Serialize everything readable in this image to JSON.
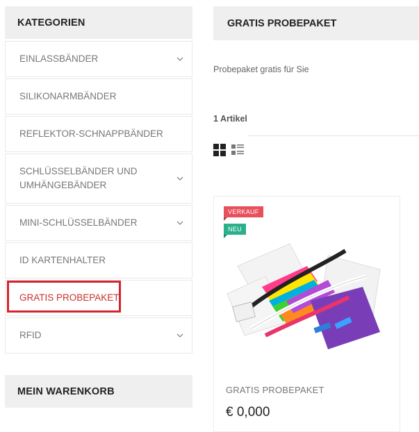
{
  "sidebar": {
    "title": "KATEGORIEN",
    "items": [
      {
        "label": "EINLASSBÄNDER",
        "has_children": true
      },
      {
        "label": "SILIKONARMBÄNDER",
        "has_children": false
      },
      {
        "label": "REFLEKTOR-SCHNAPPBÄNDER",
        "has_children": false
      },
      {
        "label": "SCHLÜSSELBÄNDER UND UMHÄNGEBÄNDER",
        "has_children": true
      },
      {
        "label": "MINI-SCHLÜSSELBÄNDER",
        "has_children": true
      },
      {
        "label": "ID KARTENHALTER",
        "has_children": false
      },
      {
        "label": "GRATIS PROBEPAKET",
        "has_children": false,
        "active": true
      },
      {
        "label": "RFID",
        "has_children": true
      }
    ],
    "cart_title": "MEIN WARENKORB"
  },
  "main": {
    "title": "GRATIS PROBEPAKET",
    "description": "Probepaket gratis für Sie",
    "count": "1 Artikel",
    "product": {
      "badge_sale": "VERKAUF",
      "badge_new": "NEU",
      "name": "GRATIS PROBEPAKET",
      "price": "€ 0,000"
    }
  },
  "colors": {
    "active": "#c9302c",
    "highlight": "#d3232c",
    "sale": "#e8505b",
    "new": "#2bb08b"
  },
  "icons": {
    "chevron": "chevron-down-icon",
    "grid": "grid-view-icon",
    "list": "list-view-icon"
  }
}
